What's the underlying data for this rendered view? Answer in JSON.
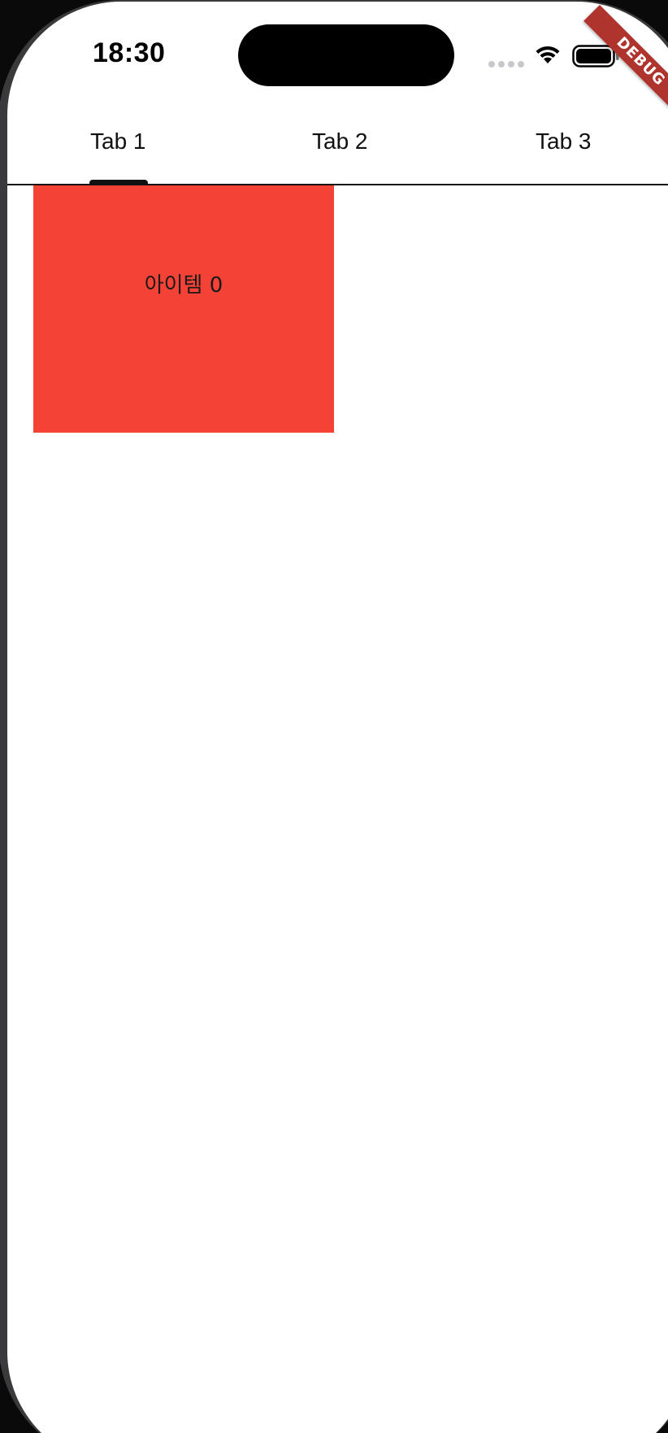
{
  "status_bar": {
    "time": "18:30",
    "icons": [
      "signal-dots-icon",
      "wifi-icon",
      "battery-icon"
    ]
  },
  "debug_banner": {
    "label": "DEBUG",
    "color": "#b0342e"
  },
  "tabs": [
    {
      "label": "Tab 1",
      "selected": true
    },
    {
      "label": "Tab 2",
      "selected": false
    },
    {
      "label": "Tab 3",
      "selected": false
    }
  ],
  "items": [
    {
      "label": "아이템 0",
      "color": "#f44336"
    }
  ]
}
